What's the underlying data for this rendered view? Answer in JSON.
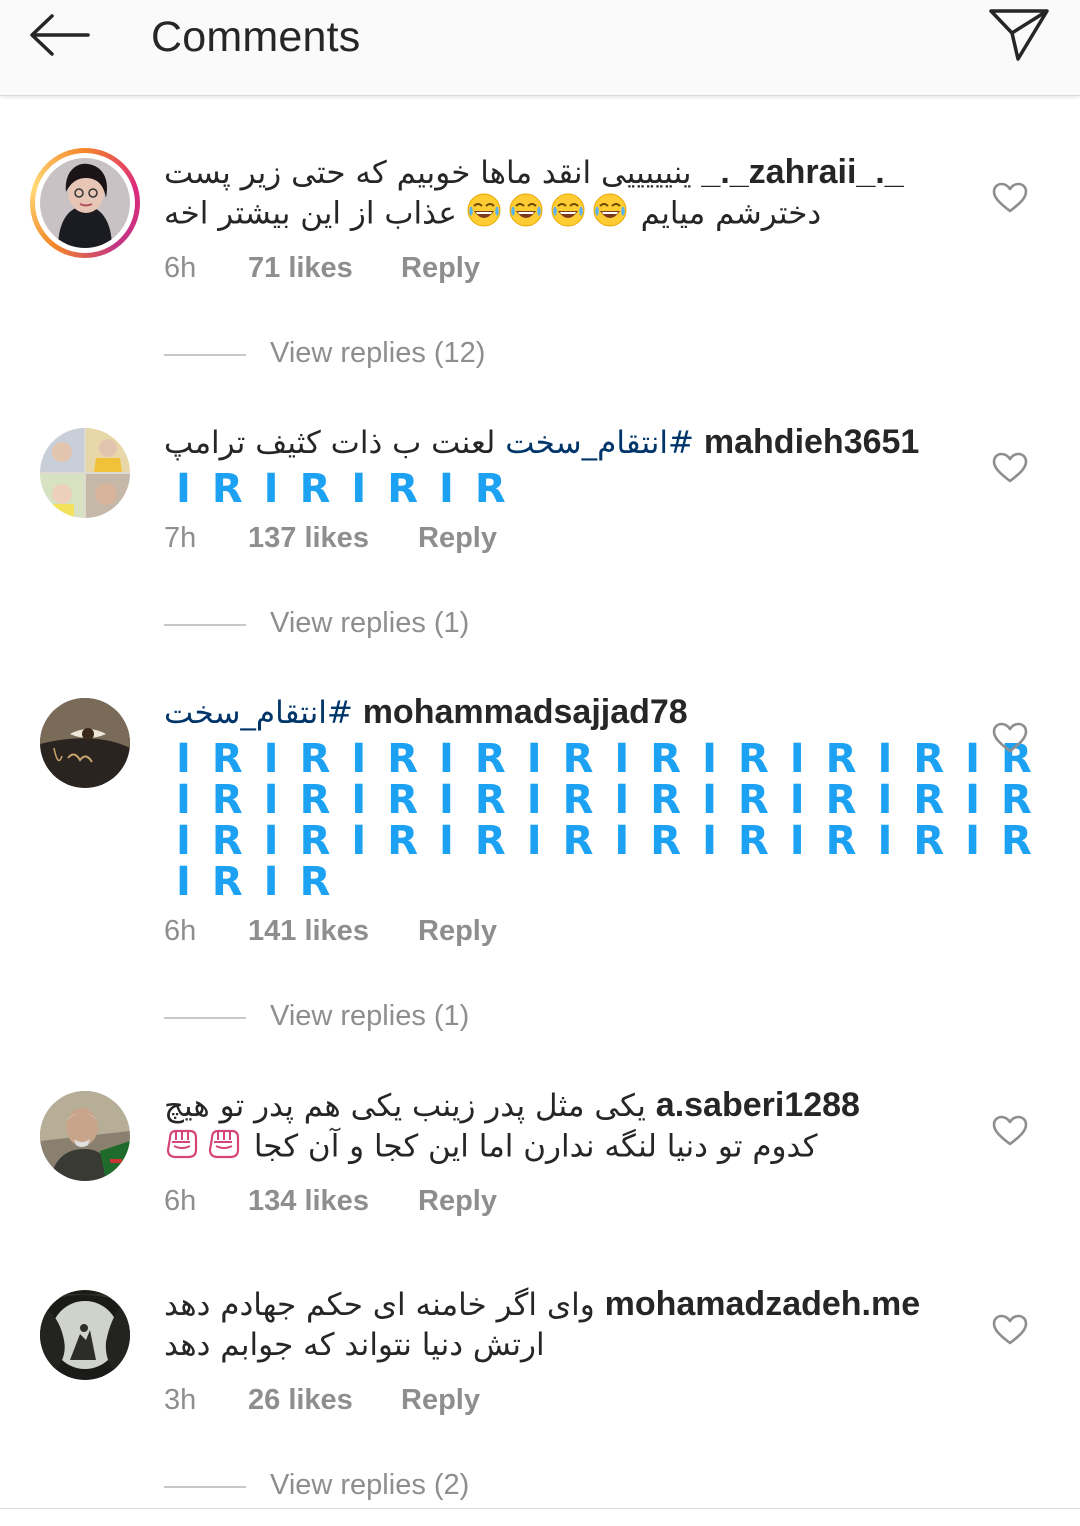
{
  "header": {
    "title": "Comments",
    "back_icon": "arrow-left-icon",
    "send_icon": "paper-plane-icon"
  },
  "colors": {
    "hashtag": "#003569",
    "meta_gray": "#8e8e8e",
    "ir_blue": "#1da1f2"
  },
  "comments": [
    {
      "username": "_._zahraii_._",
      "lines": [
        "ینیییییی انقد ماها خوبیم که حتی زیر پست",
        "دخترشم میایم",
        "عذاب از این بیشتر اخه"
      ],
      "emoji": "tears-of-joy",
      "emoji_count": 4,
      "time": "6h",
      "likes": "71 likes",
      "reply": "Reply",
      "view_replies": "View replies (12)",
      "has_story_ring": true
    },
    {
      "username": "mahdieh3651",
      "text": "لعنت ب ذات کثیف ترامپ",
      "hashtag": "#انتقام_سخت",
      "ir_lines": [
        "IRIRIRIR"
      ],
      "time": "7h",
      "likes": "137 likes",
      "reply": "Reply",
      "view_replies": "View replies (1)"
    },
    {
      "username": "mohammadsajjad78",
      "hashtag": "#انتقام_سخت",
      "ir_lines": [
        "IRIRIRIRIRIRIRIRIRIR",
        "IRIRIRIRIRIRIRIRIRIR",
        "IRIRIRIRIRIRIRIRIRIR",
        "IRIR"
      ],
      "time": "6h",
      "likes": "141 likes",
      "reply": "Reply",
      "view_replies": "View replies (1)"
    },
    {
      "username": "a.saberi1288",
      "lines": [
        "یکی مثل پدر زینب  یکی هم پدر تو  هیچ",
        "کدوم تو دنیا لنگه ندارن اما این کجا و آن کجا"
      ],
      "emoji": "raised-fist",
      "emoji_count": 2,
      "time": "6h",
      "likes": "134 likes",
      "reply": "Reply"
    },
    {
      "username": "mohamadzadeh.me",
      "lines": [
        "وای اگر خامنه ای حکم جهادم دهد",
        "ارتش دنیا نتواند که جوابم دهد"
      ],
      "time": "3h",
      "likes": "26 likes",
      "reply": "Reply",
      "view_replies": "View replies (2)"
    }
  ]
}
